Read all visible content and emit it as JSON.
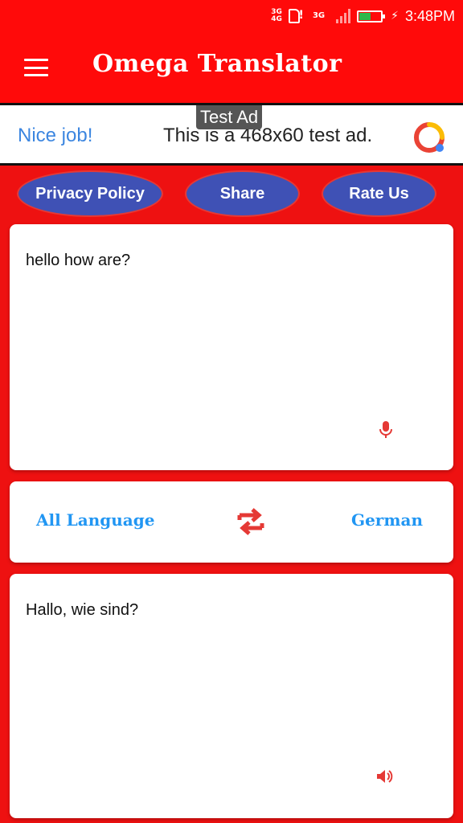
{
  "status_bar": {
    "net1_top": "3G",
    "net1_bottom": "4G",
    "net2": "3G",
    "time": "3:48PM",
    "battery_level": 0.55
  },
  "app_bar": {
    "title": "Omega Translator",
    "menu_icon": "hamburger-menu-icon"
  },
  "ad": {
    "tag": "Test Ad",
    "nice": "Nice job!",
    "text": "This is a 468x60 test ad.",
    "logo_icon": "admob-logo-icon"
  },
  "actions": {
    "privacy": "Privacy Policy",
    "share": "Share",
    "rate": "Rate Us"
  },
  "source": {
    "text": "hello how are?",
    "mic_icon": "mic-icon"
  },
  "languages": {
    "from": "All Language",
    "to": "German",
    "swap_icon": "swap-icon"
  },
  "target": {
    "text": "Hallo, wie sind?",
    "speaker_icon": "speaker-icon"
  },
  "colors": {
    "primary_red": "#FF0A0A",
    "background_red": "#EE1111",
    "pill_blue": "#3F51B5",
    "language_blue": "#2196F3",
    "icon_red": "#E53935"
  }
}
